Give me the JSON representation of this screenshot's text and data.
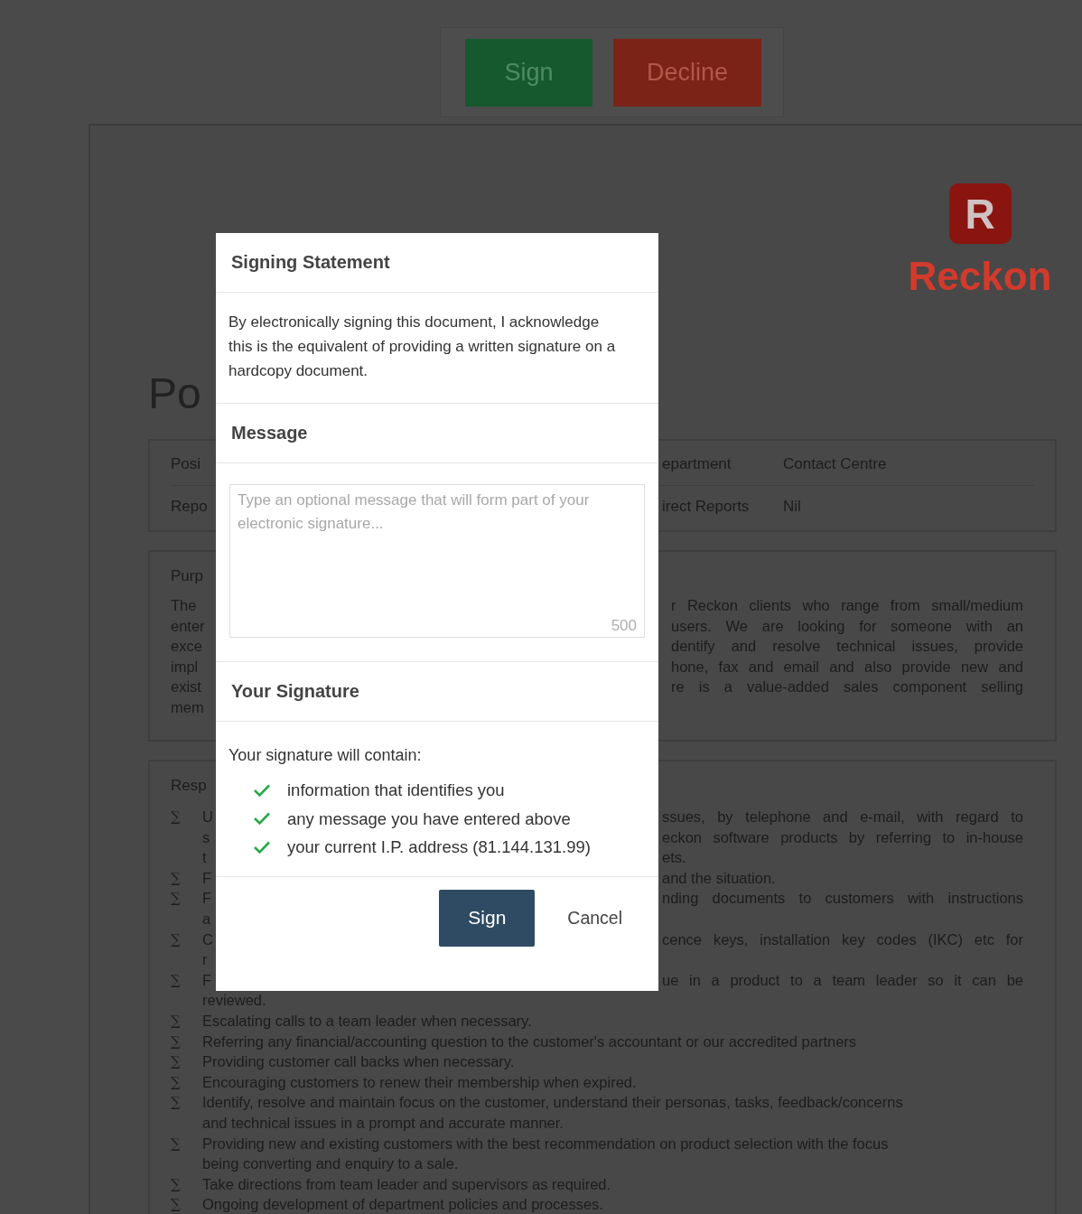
{
  "toolbar": {
    "buttons": [
      {
        "label": "Sign",
        "kind": "sign"
      },
      {
        "label": "Decline",
        "kind": "decline"
      }
    ]
  },
  "document": {
    "logo": {
      "letter": "R",
      "name": "Reckon"
    },
    "title": "Po",
    "info_rows": [
      {
        "label": "Posi",
        "field": "epartment",
        "value": "Contact Centre"
      },
      {
        "label": "Repo",
        "field": "irect Reports",
        "value": "Nil"
      }
    ],
    "purpose": {
      "heading": "Purp",
      "left": [
        "The",
        "enter",
        "exce",
        "impl",
        "exist",
        "mem"
      ],
      "right": [
        "r Reckon clients who range from small/medium",
        "users.  We are looking for someone with an",
        "dentify and resolve technical issues, provide",
        "hone, fax and email and also provide new and",
        "re is a value-added sales component selling"
      ]
    },
    "responsibilities": {
      "heading": "Resp",
      "bullet": "∑",
      "partial_items": [
        {
          "left": [
            "U",
            "s",
            "t"
          ],
          "right": [
            "ssues, by telephone and e-mail, with regard to",
            "eckon software products by referring to in-house",
            "ets."
          ]
        },
        {
          "left": [
            "F"
          ],
          "right": [
            "and the situation."
          ]
        },
        {
          "left": [
            "F",
            "a"
          ],
          "right": [
            "nding documents to customers with instructions"
          ]
        },
        {
          "left": [
            "C",
            "r"
          ],
          "right": [
            "cence keys, installation key codes (IKC) etc for"
          ]
        },
        {
          "left": [
            "F"
          ],
          "right": [
            "ue in a product to a team leader so it can be"
          ],
          "continued": "reviewed."
        }
      ],
      "items": [
        {
          "lines": [
            "Escalating calls to a team leader when necessary."
          ]
        },
        {
          "lines": [
            "Referring any financial/accounting question to the customer's accountant or our accredited partners"
          ]
        },
        {
          "lines": [
            "Providing customer call backs when necessary."
          ]
        },
        {
          "lines": [
            "Encouraging customers to renew their membership when expired."
          ]
        },
        {
          "lines": [
            "Identify, resolve and maintain focus on the customer, understand their personas, tasks, feedback/concerns",
            "and technical issues in a prompt and accurate manner."
          ]
        },
        {
          "lines": [
            "Providing new and existing customers with the best recommendation on product selection with the focus",
            "being converting and enquiry to a sale."
          ]
        },
        {
          "lines": [
            "Take directions from team leader and supervisors as required."
          ]
        },
        {
          "lines": [
            "Ongoing development of department policies and processes."
          ]
        }
      ]
    }
  },
  "dialog": {
    "sections": [
      {
        "kind": "statement",
        "heading": "Signing Statement",
        "text": "By electronically signing this document, I acknowledge this is the equivalent of providing a written signature on a hardcopy document."
      },
      {
        "kind": "message",
        "heading": "Message",
        "placeholder": "Type an optional message that will form part of your electronic signature...",
        "counter": "500"
      },
      {
        "kind": "signature",
        "heading": "Your Signature",
        "intro": "Your signature will contain:",
        "items": [
          "information that identifies you",
          "any message you have entered above",
          "your current I.P. address (81.144.131.99)"
        ]
      }
    ],
    "buttons": [
      {
        "label": "Sign",
        "kind": "primary"
      },
      {
        "label": "Cancel",
        "kind": "plain"
      }
    ]
  }
}
